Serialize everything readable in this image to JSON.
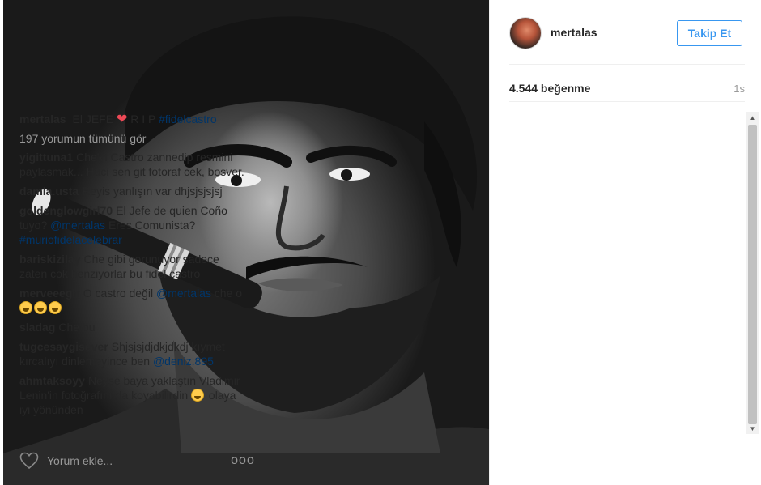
{
  "post": {
    "username": "mertalas",
    "follow_label": "Takip Et",
    "likes": "4.544 beğenme",
    "time": "1s"
  },
  "caption": {
    "user": "mertalas",
    "text_before": "El JEFE",
    "text_after": "R I P",
    "hashtag": "#fidelcastro"
  },
  "view_all": "197 yorumun tümünü gör",
  "comments": [
    {
      "user": "yigittuna1",
      "text": "Che'yi Castro zannedip resmini paylasmak... Haci sen git fotoraf cek, bosver."
    },
    {
      "user": "damla.usta",
      "text": "Reyis yanlışın var dhjsjsjsjsj"
    },
    {
      "user": "goldenglowgirl70",
      "text": "El Jefe de quien Coño tuyo?",
      "mention": "@mertalas",
      "text2": "Eres Comunista?",
      "hashtag": "#muriofidelacelebrar"
    },
    {
      "user": "bariskizilay",
      "text": "Che gibi gorunuyor sadece zaten cok benziyorlar bu fidel castro"
    },
    {
      "user": "merveeeglr",
      "text": "O castro değil",
      "mention": "@mertalas",
      "text2": "che o"
    },
    {
      "user": "sladag",
      "text": "Che bu"
    },
    {
      "user": "tugcesaygisever",
      "text": "Shjsjsjdjdkjdkdj kıymet kırcalıyı dinlemeyince ben",
      "mention": "@deniz.895"
    },
    {
      "user": "ahmtaksoyy",
      "text": "Neyse baya yaklaştın Vladimir Lenin'in fotoğrafını da koyabilirdin",
      "text2": "olaya iyi yönünden"
    }
  ],
  "footer": {
    "placeholder": "Yorum ekle...",
    "more": "ooo"
  },
  "colors": {
    "accent": "#3897f0",
    "heart": "#ed4956",
    "link": "#003569",
    "muted": "#999999"
  },
  "icons": [
    "heart-icon",
    "heart-outline-icon",
    "more-options-icon",
    "grinning-emoji-icon",
    "scroll-up-arrow",
    "scroll-down-arrow"
  ]
}
